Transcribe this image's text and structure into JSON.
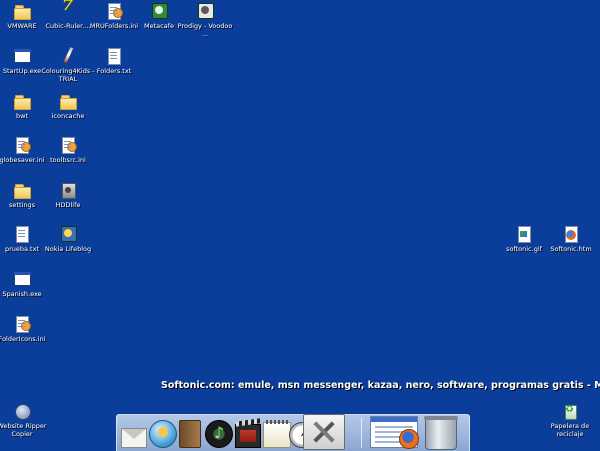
{
  "desktop": {
    "icons": [
      {
        "label": "VMWARE",
        "icon": "folder-icon"
      },
      {
        "label": "Cubic-Ruler....",
        "icon": "cubic-ruler-icon"
      },
      {
        "label": "MRUFolders.ini",
        "icon": "ini-file-icon"
      },
      {
        "label": "Metacafe",
        "icon": "metacafe-icon"
      },
      {
        "label": "Prodigy - Voodoo ...",
        "icon": "media-file-icon"
      },
      {
        "label": "StartUp.exe",
        "icon": "exe-window-icon"
      },
      {
        "label": "Colouring4Kids -TRIAL",
        "icon": "brush-icon"
      },
      {
        "label": "Folders.txt",
        "icon": "text-file-icon"
      },
      {
        "label": "bwt",
        "icon": "folder-icon"
      },
      {
        "label": "iconcache",
        "icon": "folder-icon"
      },
      {
        "label": "globesaver.ini",
        "icon": "ini-file-icon"
      },
      {
        "label": "toolbsrc.ini",
        "icon": "ini-file-icon"
      },
      {
        "label": "settings",
        "icon": "folder-icon"
      },
      {
        "label": "HDDlife",
        "icon": "hdd-icon"
      },
      {
        "label": "prueba.txt",
        "icon": "text-file-icon"
      },
      {
        "label": "Nokia Lifeblog",
        "icon": "lifeblog-icon"
      },
      {
        "label": "Spanish.exe",
        "icon": "exe-window-icon"
      },
      {
        "label": "FolderIcons.ini",
        "icon": "ini-file-icon"
      },
      {
        "label": "softonic.gif",
        "icon": "gif-file-icon"
      },
      {
        "label": "Softonic.htm",
        "icon": "firefox-html-icon"
      },
      {
        "label": "Website Ripper Copier",
        "icon": "website-ripper-icon"
      },
      {
        "label": "Papelera de reciclaje",
        "icon": "recycle-bin-icon"
      }
    ]
  },
  "window_title": "Softonic.com: emule, msn messenger, kazaa, nero, software, programas gratis - Mozilla Firefox",
  "dock": {
    "items": [
      {
        "name": "mail-icon"
      },
      {
        "name": "msn-messenger-icon"
      },
      {
        "name": "address-book-icon"
      },
      {
        "name": "music-player-icon"
      },
      {
        "name": "movie-clapper-icon"
      },
      {
        "name": "notepad-icon"
      },
      {
        "name": "clock-icon"
      },
      {
        "name": "system-tools-icon"
      },
      {
        "name": "firefox-window-icon"
      },
      {
        "name": "firefox-icon"
      },
      {
        "name": "trash-icon"
      }
    ]
  },
  "colors": {
    "desktop_background": "#0b3d9a",
    "text": "#ffffff"
  }
}
